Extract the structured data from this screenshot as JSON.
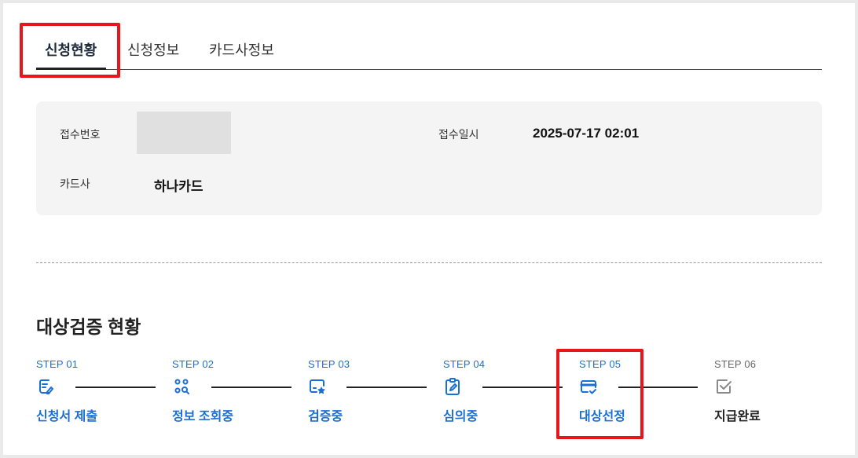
{
  "tabs": [
    {
      "label": "신청현황",
      "active": true
    },
    {
      "label": "신청정보",
      "active": false
    },
    {
      "label": "카드사정보",
      "active": false
    }
  ],
  "info": {
    "receipt_no_label": "접수번호",
    "receipt_no_value": "",
    "receipt_date_label": "접수일시",
    "receipt_date_value": "2025-07-17 02:01",
    "card_company_label": "카드사",
    "card_company_value": "하나카드"
  },
  "section_title": "대상검증 현황",
  "steps": [
    {
      "no": "STEP 01",
      "label": "신청서 제출",
      "icon": "document-pen-icon",
      "active": true
    },
    {
      "no": "STEP 02",
      "label": "정보 조회중",
      "icon": "people-search-icon",
      "active": true
    },
    {
      "no": "STEP 03",
      "label": "검증중",
      "icon": "screen-star-icon",
      "active": true
    },
    {
      "no": "STEP 04",
      "label": "심의중",
      "icon": "clipboard-pen-icon",
      "active": true
    },
    {
      "no": "STEP 05",
      "label": "대상선정",
      "icon": "card-check-icon",
      "active": true
    },
    {
      "no": "STEP 06",
      "label": "지급완료",
      "icon": "checkbox-icon",
      "active": false
    }
  ],
  "colors": {
    "accent": "#1a6fd6",
    "highlight": "#e8161b",
    "panel": "#f4f4f4"
  }
}
